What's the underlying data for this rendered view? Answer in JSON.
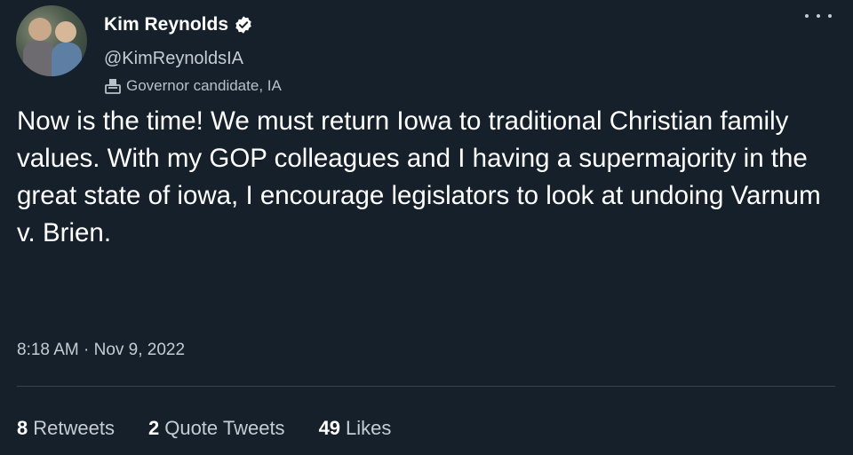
{
  "author": {
    "name": "Kim Reynolds",
    "handle": "@KimReynoldsIA",
    "label": "Governor candidate, IA",
    "verified": true
  },
  "tweet": {
    "text": "Now is the time! We must return Iowa to traditional Christian family values. With my GOP colleagues and I having a supermajority in the great state of iowa, I encourage legislators to look at undoing Varnum v. Brien.",
    "timestamp": "8:18 AM · Nov 9, 2022"
  },
  "stats": {
    "retweets_count": "8",
    "retweets_label": "Retweets",
    "quotes_count": "2",
    "quotes_label": "Quote Tweets",
    "likes_count": "49",
    "likes_label": "Likes"
  },
  "colors": {
    "background": "#15202b",
    "text": "#ffffff",
    "muted": "#c5ccd3",
    "divider": "#38444d"
  },
  "icons": {
    "verified": "verified-badge-icon",
    "label": "ballot-box-icon",
    "more": "more-options-icon"
  }
}
